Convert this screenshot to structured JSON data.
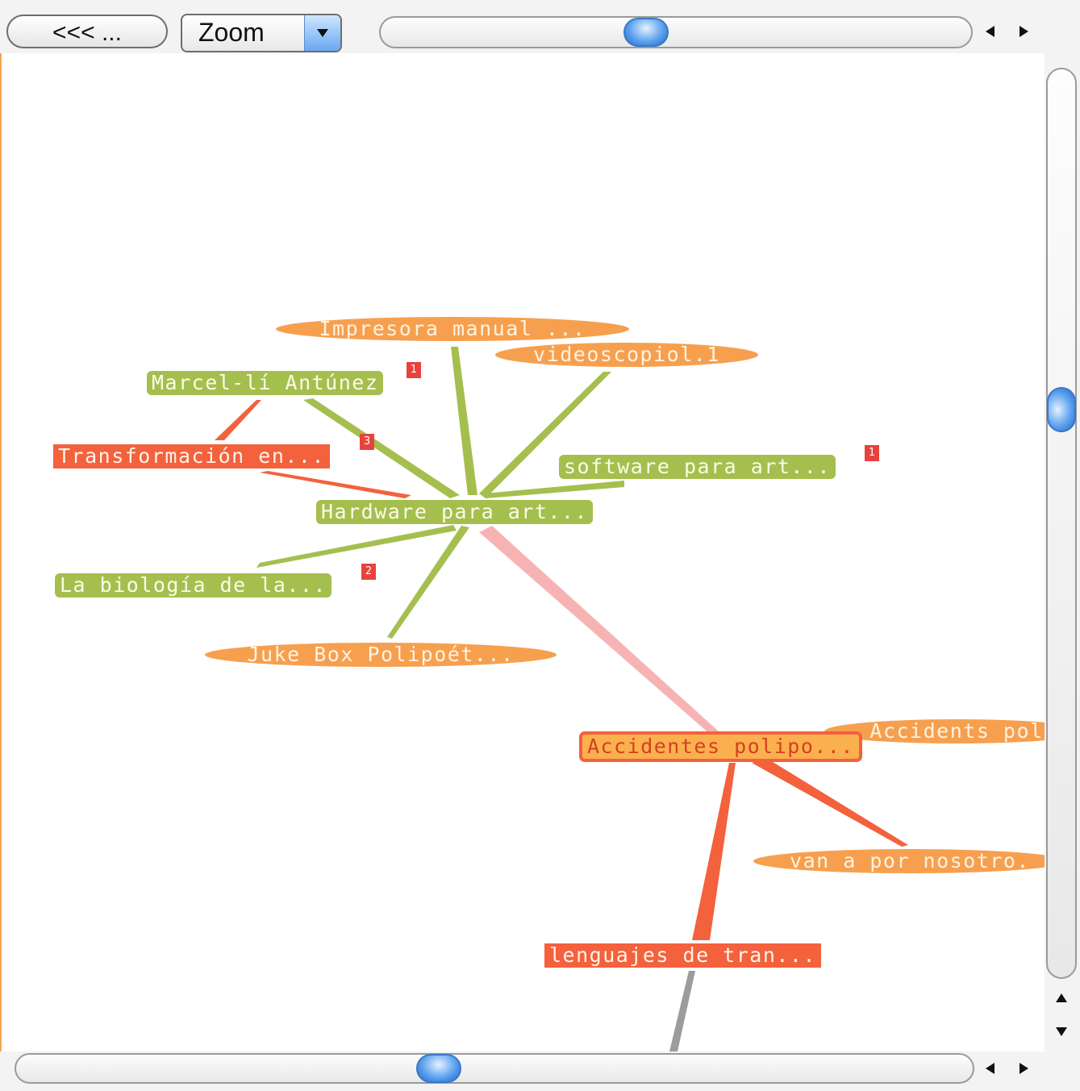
{
  "toolbar": {
    "back_label": "<<< ...",
    "zoom_label": "Zoom"
  },
  "map": {
    "center": {
      "label": "Hardware para art..."
    },
    "nodes": [
      {
        "id": "impresora",
        "label": "Impresora manual ..."
      },
      {
        "id": "videoscopio",
        "label": "videoscopiol.1"
      },
      {
        "id": "marcel",
        "label": "Marcel-lí Antúnez",
        "badge": "1"
      },
      {
        "id": "transformacion",
        "label": "Transformación en...",
        "badge": "3"
      },
      {
        "id": "software",
        "label": "software para art...",
        "badge": "1"
      },
      {
        "id": "biologia",
        "label": "La biología de la...",
        "badge": "2"
      },
      {
        "id": "jukebox",
        "label": "Juke Box Polipoét..."
      },
      {
        "id": "accidentes",
        "label": "Accidentes polipo..."
      },
      {
        "id": "accidents",
        "label": "Accidents pol"
      },
      {
        "id": "van",
        "label": "van a por nosotro."
      },
      {
        "id": "lenguajes",
        "label": "lenguajes de tran..."
      }
    ]
  },
  "colors": {
    "green": "#a5bf4f",
    "red": "#f3613d",
    "orange": "#f6a04f",
    "pink": "#f7b3b3",
    "scroll_blue": "#5fa3ef"
  },
  "icons": [
    "dropdown-arrow-icon",
    "scroll-left-icon",
    "scroll-right-icon",
    "scroll-up-icon",
    "scroll-down-icon"
  ]
}
